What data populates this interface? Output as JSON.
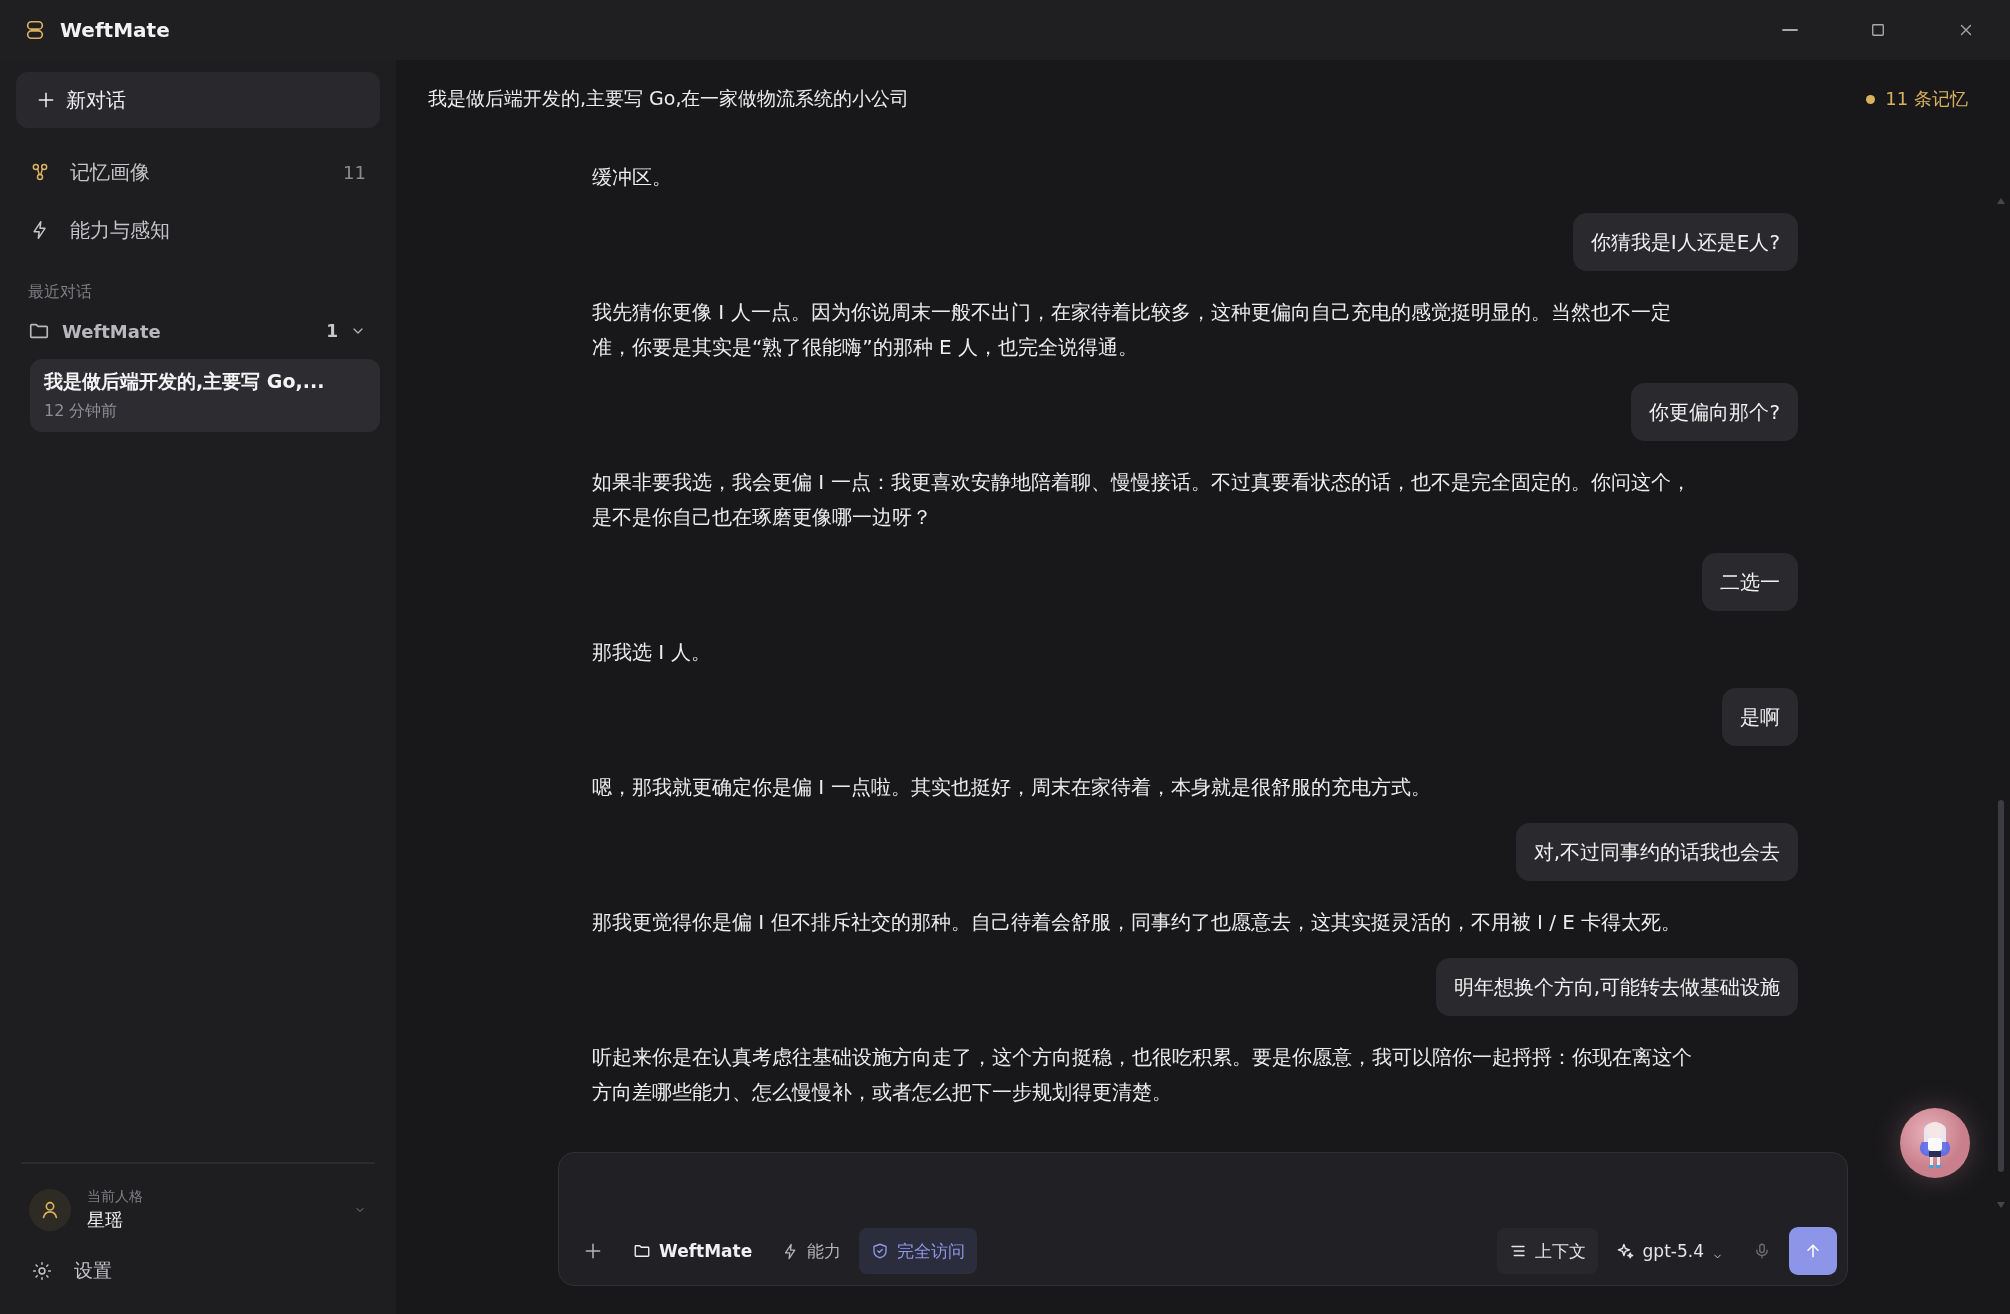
{
  "window": {
    "title": "WeftMate"
  },
  "sidebar": {
    "new_chat": "新对话",
    "nav": [
      {
        "label": "记忆画像",
        "count": "11"
      },
      {
        "label": "能力与感知"
      }
    ],
    "section_label": "最近对话",
    "folder": {
      "name": "WeftMate",
      "count": "1",
      "expanded": true
    },
    "conversations": [
      {
        "title": "我是做后端开发的,主要写 Go,...",
        "time": "12 分钟前",
        "selected": true
      }
    ],
    "persona": {
      "label": "当前人格",
      "name": "星瑶"
    },
    "settings": "设置"
  },
  "chat": {
    "title": "我是做后端开发的,主要写 Go,在一家做物流系统的小公司",
    "memory_badge": "11 条记忆",
    "messages": [
      {
        "kind": "assistant",
        "text": "缓冲区。"
      },
      {
        "kind": "user",
        "text": "你猜我是I人还是E人?"
      },
      {
        "kind": "assistant",
        "text": "我先猜你更像 I 人一点。因为你说周末一般不出门，在家待着比较多，这种更偏向自己充电的感觉挺明显的。当然也不一定准，你要是其实是“熟了很能嗨”的那种 E 人，也完全说得通。"
      },
      {
        "kind": "user",
        "text": "你更偏向那个?"
      },
      {
        "kind": "assistant",
        "text": "如果非要我选，我会更偏 I 一点：我更喜欢安静地陪着聊、慢慢接话。不过真要看状态的话，也不是完全固定的。你问这个，是不是你自己也在琢磨更像哪一边呀？"
      },
      {
        "kind": "user",
        "text": "二选一"
      },
      {
        "kind": "assistant",
        "text": "那我选 I 人。"
      },
      {
        "kind": "user",
        "text": "是啊"
      },
      {
        "kind": "assistant",
        "text": "嗯，那我就更确定你是偏 I 一点啦。其实也挺好，周末在家待着，本身就是很舒服的充电方式。"
      },
      {
        "kind": "user",
        "text": "对,不过同事约的话我也会去"
      },
      {
        "kind": "assistant",
        "text": "那我更觉得你是偏 I 但不排斥社交的那种。自己待着会舒服，同事约了也愿意去，这其实挺灵活的，不用被 I / E 卡得太死。"
      },
      {
        "kind": "user",
        "text": "明年想换个方向,可能转去做基础设施"
      },
      {
        "kind": "assistant",
        "text": "听起来你是在认真考虑往基础设施方向走了，这个方向挺稳，也很吃积累。要是你愿意，我可以陪你一起捋捋：你现在离这个方向差哪些能力、怎么慢慢补，或者怎么把下一步规划得更清楚。"
      }
    ],
    "composer": {
      "project": "WeftMate",
      "capability": "能力",
      "access": {
        "label": "完全访问",
        "on": true
      },
      "context": "上下文",
      "model": "gpt-5.4"
    }
  }
}
